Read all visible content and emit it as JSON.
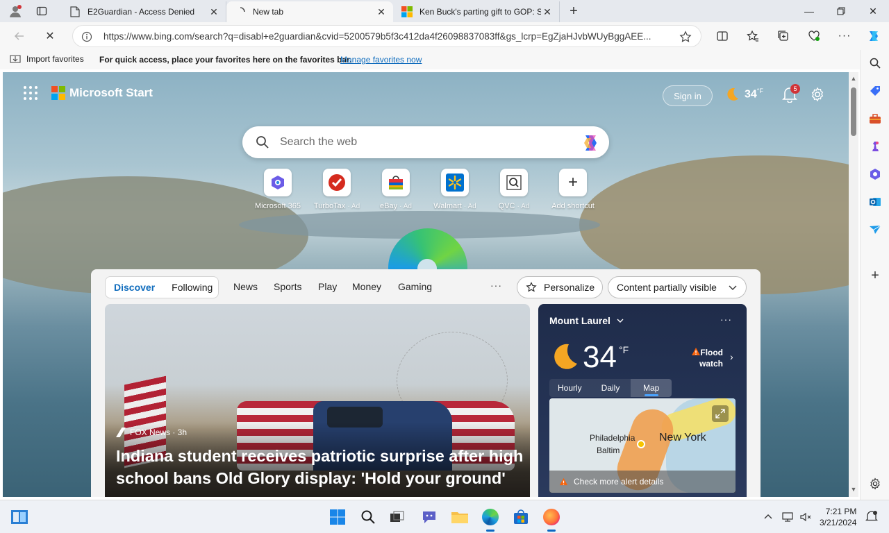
{
  "tabs": [
    {
      "title": "E2Guardian - Access Denied",
      "active": false
    },
    {
      "title": "New tab",
      "active": true
    },
    {
      "title": "Ken Buck's parting gift to GOP: S",
      "active": false
    }
  ],
  "address_bar": {
    "url": "https://www.bing.com/search?q=disabl+e2guardian&cvid=5200579b5f3c412da4f26098837083ff&gs_lcrp=EgZjaHJvbWUyBggAEE..."
  },
  "favorites_bar": {
    "import_label": "Import favorites",
    "hint": "For quick access, place your favorites here on the favorites bar.",
    "manage_link": "Manage favorites now"
  },
  "start_page": {
    "brand": "Microsoft Start",
    "sign_in": "Sign in",
    "header_temp": "34",
    "header_unit": "°F",
    "notification_count": "5",
    "search_placeholder": "Search the web",
    "shortcuts": [
      {
        "label": "Microsoft 365",
        "ad": ""
      },
      {
        "label": "TurboTax",
        "ad": "· Ad"
      },
      {
        "label": "eBay",
        "ad": "· Ad"
      },
      {
        "label": "Walmart",
        "ad": "· Ad"
      },
      {
        "label": "QVC",
        "ad": "· Ad"
      },
      {
        "label": "Add shortcut",
        "ad": ""
      }
    ],
    "feed_tabs": {
      "discover": "Discover",
      "following": "Following"
    },
    "feed_links": [
      "News",
      "Sports",
      "Play",
      "Money",
      "Gaming"
    ],
    "more": "···",
    "personalize": "Personalize",
    "content_visibility": "Content partially visible",
    "news": {
      "source": "FOX News · 3h",
      "title": "Indiana student receives patriotic surprise after high school bans Old Glory display: 'Hold your ground'"
    },
    "weather": {
      "location": "Mount Laurel",
      "temp": "34",
      "unit": "°F",
      "alert_line1": "Flood",
      "alert_line2": "watch",
      "tabs": [
        "Hourly",
        "Daily",
        "Map"
      ],
      "selected_tab": "Map",
      "map_labels": {
        "philadelphia": "Philadelphia",
        "baltimore": "Baltim",
        "new_york": "New York"
      },
      "check_alerts": "Check more alert details"
    }
  },
  "taskbar": {
    "time": "7:21 PM",
    "date": "3/21/2024"
  },
  "colors": {
    "accent": "#0f6cbd",
    "weather_card": "#1f2c4a",
    "alert_red": "#d13438"
  }
}
